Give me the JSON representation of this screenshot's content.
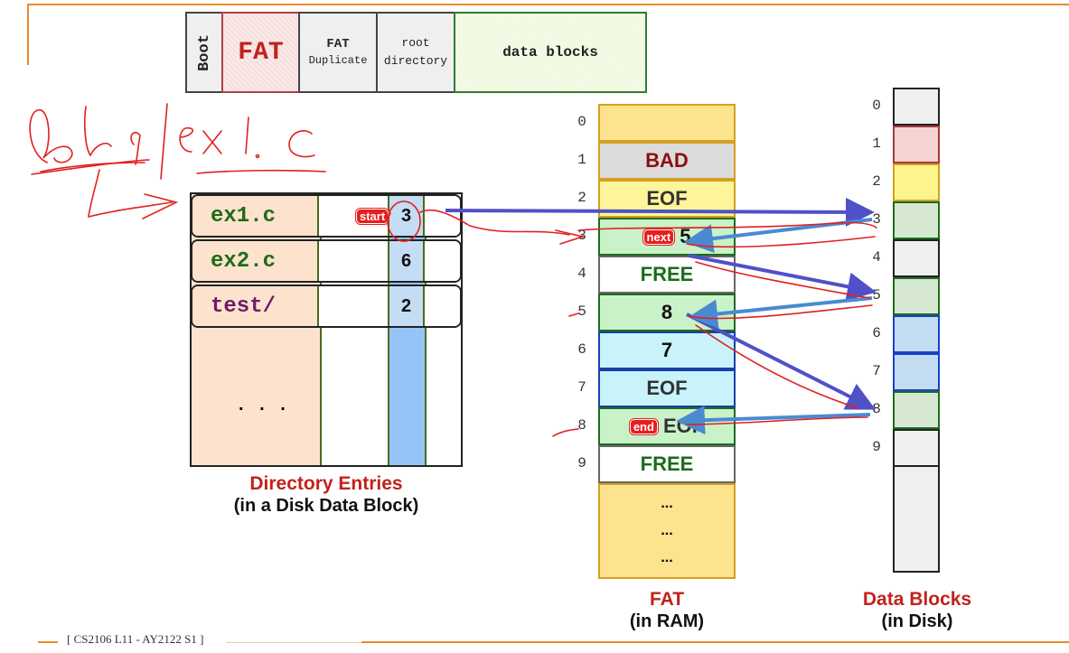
{
  "footer": "[ CS2106 L11 - AY2122 S1 ]",
  "disk_layout": {
    "boot": "Boot",
    "fat": "FAT",
    "fat_duplicate_line1": "FAT",
    "fat_duplicate_line2": "Duplicate",
    "root_line1": "root",
    "root_line2": "directory",
    "data": "data blocks"
  },
  "annotation": {
    "handwritten_path": "a/b/q/ex1.c"
  },
  "directory": {
    "entries": [
      {
        "name": "ex1.c",
        "start": "3",
        "color": "#1f6b1a"
      },
      {
        "name": "ex2.c",
        "start": "6",
        "color": "#1f6b1a"
      },
      {
        "name": "test/",
        "start": "2",
        "color": "#6a1b6a"
      }
    ],
    "ellipsis": ". . .",
    "start_badge": "start",
    "caption": "Directory Entries",
    "subcaption": "(in a Disk Data Block)"
  },
  "fat": {
    "entries": [
      {
        "index": "0",
        "value": "",
        "bg": "#fde38e",
        "border": "#d4a020",
        "color": "#111"
      },
      {
        "index": "1",
        "value": "BAD",
        "bg": "#dcdcdc",
        "border": "#d4a020",
        "color": "#8a1010"
      },
      {
        "index": "2",
        "value": "EOF",
        "bg": "#fff59a",
        "border": "#d4a020",
        "color": "#333"
      },
      {
        "index": "3",
        "value": "5",
        "bg": "#c9f2c8",
        "border": "#1e6b1e",
        "color": "#111",
        "badge": "next"
      },
      {
        "index": "4",
        "value": "FREE",
        "bg": "#ffffff",
        "border": "#666",
        "color": "#1b6b1b"
      },
      {
        "index": "5",
        "value": "8",
        "bg": "#c9f2c8",
        "border": "#1e6b1e",
        "color": "#111"
      },
      {
        "index": "6",
        "value": "7",
        "bg": "#c8f3fb",
        "border": "#1a3fa8",
        "color": "#111"
      },
      {
        "index": "7",
        "value": "EOF",
        "bg": "#c8f3fb",
        "border": "#1a3fa8",
        "color": "#333"
      },
      {
        "index": "8",
        "value": "EOF",
        "bg": "#c9f2c8",
        "border": "#1e6b1e",
        "color": "#333",
        "badge": "end"
      },
      {
        "index": "9",
        "value": "FREE",
        "bg": "#ffffff",
        "border": "#666",
        "color": "#1b6b1b"
      }
    ],
    "ellipsis": [
      "...",
      "...",
      "..."
    ],
    "caption": "FAT",
    "subcaption": "(in RAM)"
  },
  "data_blocks": {
    "blocks": [
      {
        "index": "0",
        "bg": "#efefef",
        "border": "#222"
      },
      {
        "index": "1",
        "bg": "#f6d2d2",
        "border": "#a03a3a"
      },
      {
        "index": "2",
        "bg": "#fff58e",
        "border": "#d4a020"
      },
      {
        "index": "3",
        "bg": "#d6e8d2",
        "border": "#1e6b1e"
      },
      {
        "index": "4",
        "bg": "#efefef",
        "border": "#222"
      },
      {
        "index": "5",
        "bg": "#d6e8d2",
        "border": "#1e6b1e"
      },
      {
        "index": "6",
        "bg": "#c3dcf2",
        "border": "#1a3fc8"
      },
      {
        "index": "7",
        "bg": "#c3dcf2",
        "border": "#1a3fc8"
      },
      {
        "index": "8",
        "bg": "#d6e8d2",
        "border": "#1e6b1e"
      },
      {
        "index": "9",
        "bg": "#efefef",
        "border": "#222"
      }
    ],
    "caption": "Data Blocks",
    "subcaption": "(in Disk)"
  },
  "colors": {
    "accent_orange": "#ec8a2a",
    "caption_red": "#c0231c",
    "arrow_purple": "#5050c8",
    "arrow_blue": "#4a8ad0",
    "ink_red": "#e02020"
  }
}
